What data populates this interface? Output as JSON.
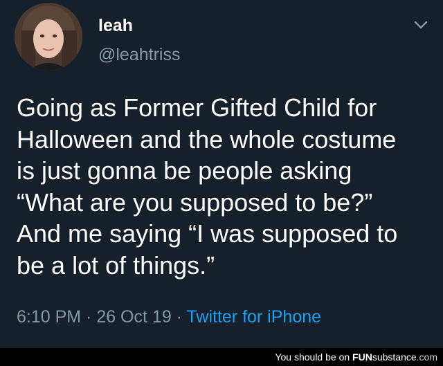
{
  "tweet": {
    "display_name": "leah",
    "handle": "@leahtriss",
    "text_lines": [
      "Going as Former Gifted Child for",
      "Halloween and the whole costume",
      "is just gonna be people asking",
      "“What are you supposed to be?”",
      "And me saying “I was supposed to",
      "be a lot of things.”"
    ],
    "time": "6:10 PM",
    "separator": " · ",
    "date": "26 Oct 19",
    "source": "Twitter for iPhone"
  },
  "icons": {
    "menu": "chevron-down-icon",
    "avatar": "profile-photo"
  },
  "colors": {
    "background": "#15202b",
    "secondary_text": "#8899a6",
    "link": "#1da1f2",
    "footer_bg": "#000000"
  },
  "footer": {
    "prefix": "You should be on ",
    "brand_bold": "FUN",
    "brand_light": "substance",
    "brand_tld": ".com"
  }
}
